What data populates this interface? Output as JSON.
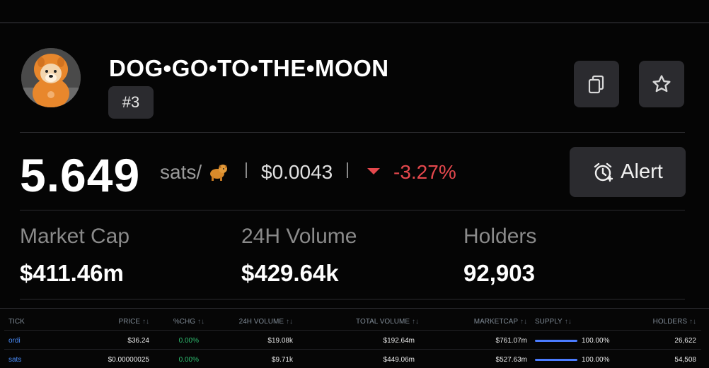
{
  "token": {
    "title": "DOG•GO•TO•THE•MOON",
    "rank": "#3",
    "price": "5.649",
    "unit": "sats/",
    "unit_icon": "dog-icon",
    "usd_price": "$0.0043",
    "change": "-3.27%",
    "change_color": "#e5484d",
    "alert_label": "Alert"
  },
  "stats": {
    "market_cap_label": "Market Cap",
    "market_cap_value": "$411.46m",
    "volume_label": "24H Volume",
    "volume_value": "$429.64k",
    "holders_label": "Holders",
    "holders_value": "92,903"
  },
  "table": {
    "headers": {
      "tick": "TICK",
      "price": "PRICE",
      "chg": "%CHG",
      "vol24": "24H VOLUME",
      "total_vol": "TOTAL VOLUME",
      "marketcap": "MARKETCAP",
      "supply": "SUPPLY",
      "holders": "HOLDERS"
    },
    "rows": [
      {
        "tick": "ordi",
        "price": "$36.24",
        "chg": "0.00%",
        "vol24": "$19.08k",
        "total_vol": "$192.64m",
        "marketcap": "$761.07m",
        "supply": "100.00%",
        "supply_fraction": 1.0,
        "holders": "26,622"
      },
      {
        "tick": "sats",
        "price": "$0.00000025",
        "chg": "0.00%",
        "vol24": "$9.71k",
        "total_vol": "$449.06m",
        "marketcap": "$527.63m",
        "supply": "100.00%",
        "supply_fraction": 1.0,
        "holders": "54,508"
      }
    ]
  },
  "colors": {
    "background": "#050505",
    "accent_blue": "#4b8fff",
    "positive": "#2fbf71",
    "negative": "#e5484d"
  }
}
